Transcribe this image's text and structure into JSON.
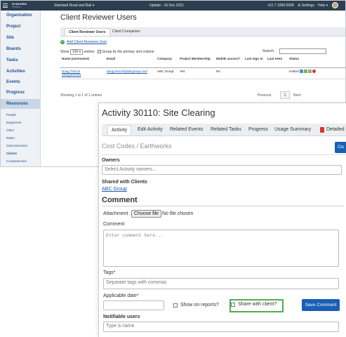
{
  "topbar": {
    "brand": "SYNCHRO",
    "brand_sub": "Perform",
    "project": "Standard Road and Rail",
    "project_caret": "▾",
    "update": "Update - 16 Dec 2021",
    "phone": "+61 7 3369 0508",
    "settings": "Settings",
    "help": "Help"
  },
  "sidebar": {
    "items": [
      "Organization",
      "Project",
      "Site",
      "Boards",
      "Tasks",
      "Activities",
      "Events",
      "Progress",
      "Resources"
    ],
    "sub_items": [
      "People",
      "Equipment",
      "Other",
      "Rates",
      "Subcontractors",
      "Clients",
      "Competencies"
    ]
  },
  "reviewer_page": {
    "title": "Client Reviewer Users",
    "tabs": [
      "Client Reviewer Users",
      "Client Companies"
    ],
    "add_link": "Add Client Reviewer User",
    "show_label": "Show",
    "page_size": "100",
    "entries_label": "entries",
    "group_label": "Group by the primary sort column",
    "search_label": "Search:",
    "columns": [
      "Name (Username)",
      "Email",
      "Company",
      "Project Membership",
      "Mobile access?",
      "Last sign in",
      "Last seen",
      "Status"
    ],
    "rows": [
      {
        "name": "Doug Trench",
        "username": "(doug.trench)",
        "email": "doug.trench@abcgroup.com",
        "company": "ABC Group",
        "membership": "Yes",
        "mobile": "No",
        "last_sign_in": "",
        "last_seen": "",
        "status": "Invited"
      }
    ],
    "showing": "Showing 1 to 1 of 1 entries",
    "prev": "Previous",
    "page": "1",
    "next": "Next"
  },
  "activity_page": {
    "title": "Activity 30110: Site Clearing",
    "tabs": [
      "Activity",
      "Edit Activity",
      "Related Events",
      "Related Tasks",
      "Progress",
      "Usage Summary",
      "Detailed"
    ],
    "cost_code": "Cost Codes / Earthworks",
    "close_button": "Clo",
    "owners_label": "Owners",
    "owners_placeholder": "Select Activity owners...",
    "shared_label": "Shared with Clients",
    "shared_client": "ABC Group",
    "comment_heading": "Comment",
    "attachment_label": "Attachment",
    "choose_file": "Choose file",
    "no_file": "No file chosen",
    "comment_label": "Comment",
    "comment_placeholder": "Enter comment here...",
    "tags_label": "Tags*",
    "tags_placeholder": "Separate tags with commas",
    "date_label": "Applicable date*",
    "show_on_reports": "Show on reports?",
    "share_with_client": "Share with client?",
    "save_button": "Save Comment",
    "notifiable_label": "Notifiable users",
    "notifiable_placeholder": "Type a name"
  },
  "colors": {
    "topbar": "#2c3e50",
    "link": "#1a56a8",
    "primary_button": "#1a5fb4",
    "highlight_box": "#4caf50",
    "sidebar_active": "#c9d6e6"
  }
}
